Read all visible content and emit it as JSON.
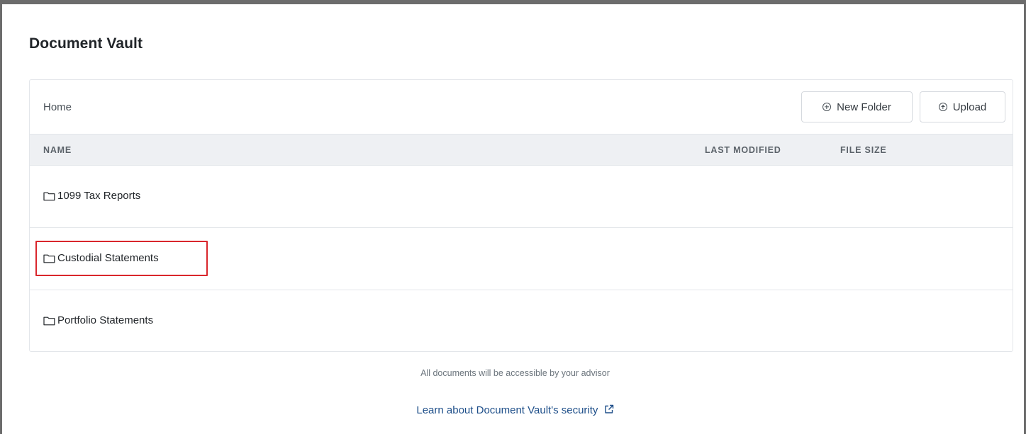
{
  "page": {
    "title": "Document Vault"
  },
  "toolbar": {
    "breadcrumb": "Home",
    "new_folder_label": "New Folder",
    "upload_label": "Upload"
  },
  "table": {
    "columns": [
      "NAME",
      "LAST MODIFIED",
      "FILE SIZE"
    ],
    "rows": [
      {
        "name": "1099 Tax Reports",
        "last_modified": "",
        "file_size": "",
        "icon": "folder-icon",
        "highlighted": false
      },
      {
        "name": "Custodial Statements",
        "last_modified": "",
        "file_size": "",
        "icon": "folder-icon",
        "highlighted": true
      },
      {
        "name": "Portfolio Statements",
        "last_modified": "",
        "file_size": "",
        "icon": "folder-icon",
        "highlighted": false
      }
    ]
  },
  "footer": {
    "note": "All documents will be accessible by your advisor",
    "security_link": "Learn about Document Vault's security",
    "security_link_icon": "external-link-icon"
  },
  "colors": {
    "link": "#1d4e89",
    "highlight": "#d9262c",
    "header_bg": "#eef0f3"
  }
}
